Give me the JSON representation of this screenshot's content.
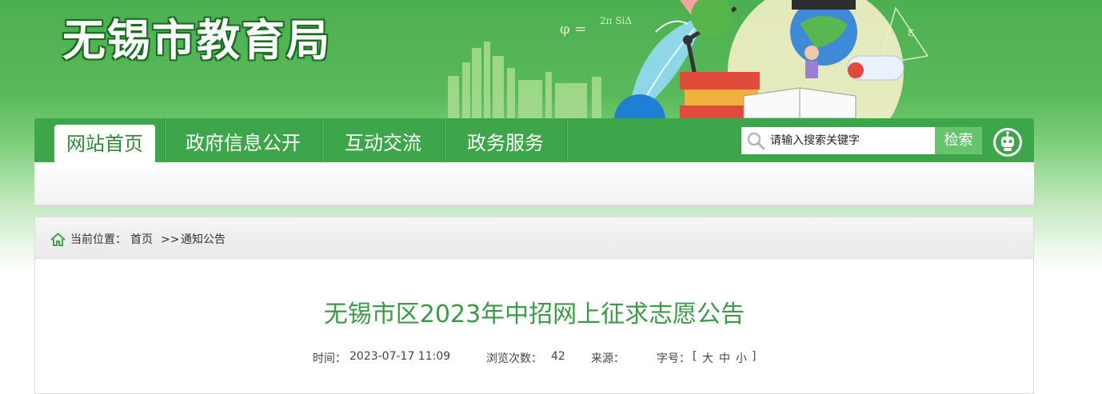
{
  "header": {
    "site_title": "无锡市教育局"
  },
  "nav": {
    "items": [
      {
        "label": "网站首页",
        "active": true
      },
      {
        "label": "政府信息公开"
      },
      {
        "label": "互动交流"
      },
      {
        "label": "政务服务"
      }
    ],
    "search": {
      "placeholder": "请输入搜索关键字",
      "button_label": "检索"
    },
    "assistant_icon": "robot-icon"
  },
  "breadcrumb": {
    "prefix": "当前位置：",
    "items": [
      "首页",
      "通知公告"
    ],
    "separator": ">>"
  },
  "article": {
    "title": "无锡市区2023年中招网上征求志愿公告",
    "time_label": "时间：",
    "time_value": "2023-07-17 11:09",
    "views_label": "浏览次数：",
    "views_value": "42",
    "source_label": "来源：",
    "source_value": "",
    "font_size_label": "字号：",
    "font_size_open": "[",
    "font_size_large": "大",
    "font_size_medium": "中",
    "font_size_small": "小",
    "font_size_close": "]"
  },
  "colors": {
    "brand_green": "#3ea64a",
    "title_green": "#3a9a46",
    "search_button": "#66c46f"
  }
}
